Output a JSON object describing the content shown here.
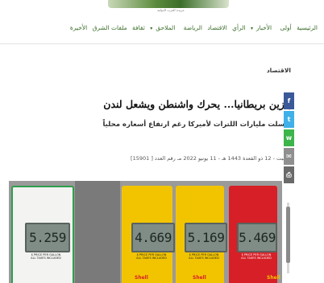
{
  "header": {
    "logo_tagline": "جريدة العرب الدولية"
  },
  "nav": {
    "items": [
      {
        "label": "الرئيسية",
        "dropdown": false
      },
      {
        "label": "أولى",
        "dropdown": false
      },
      {
        "label": "الأخبار",
        "dropdown": true
      },
      {
        "label": "الرأي",
        "dropdown": false
      },
      {
        "label": "الاقتصاد",
        "dropdown": false
      },
      {
        "label": "الرياضة",
        "dropdown": false
      },
      {
        "label": "الملاحق",
        "dropdown": true
      },
      {
        "label": "ثقافة",
        "dropdown": false
      },
      {
        "label": "ملفات الشرق",
        "dropdown": false
      },
      {
        "label": "الأخيرة",
        "dropdown": false
      }
    ]
  },
  "article": {
    "section": "الاقتصاد",
    "headline": "بنزين بريطانيا... يحرك واشنطن ويشعل لندن",
    "subhead": "أرسلت مليارات اللترات لأميركا رغم ارتفاع أسعاره محلياً",
    "meta": "السبت - 12 ذو القعدة 1443 هـ - 11 يونيو 2022 مـ رقم العدد [ 15901]"
  },
  "social": {
    "facebook": "f",
    "twitter": "t",
    "whatsapp": "w",
    "email": "✉",
    "print": "⎙"
  },
  "photo": {
    "displays": [
      "5.259",
      "4.669",
      "5.169",
      "5.469"
    ],
    "price_note": "$ PRICE PER GALLON ALL TAXES INCLUDED",
    "brand": "Shell"
  },
  "colors": {
    "accent": "#3b6e2a",
    "pump_yellow": "#f2c400",
    "pump_red": "#d61f26",
    "pump_green_border": "#2e9e4e"
  }
}
